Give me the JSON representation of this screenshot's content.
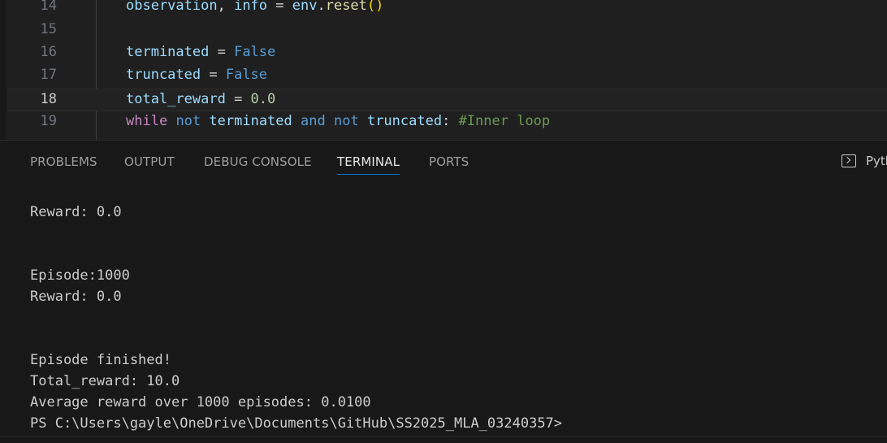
{
  "editor": {
    "lines": [
      {
        "number": "14",
        "code": "observation, info = env.reset()"
      },
      {
        "number": "15",
        "code": ""
      },
      {
        "number": "16",
        "code": "terminated = False"
      },
      {
        "number": "17",
        "code": "truncated = False"
      },
      {
        "number": "18",
        "code": "total_reward = 0.0"
      },
      {
        "number": "19",
        "code": "while not terminated and not truncated: #Inner loop"
      }
    ],
    "tokens": {
      "l14": [
        "observation",
        ", ",
        "info",
        " = ",
        "env",
        ".",
        "reset",
        "(",
        ")"
      ],
      "l16": [
        "terminated",
        " = ",
        "False"
      ],
      "l17": [
        "truncated",
        " = ",
        "False"
      ],
      "l18": [
        "total_reward",
        " = ",
        "0.0"
      ],
      "l19": [
        "while",
        " ",
        "not",
        " ",
        "terminated",
        " ",
        "and",
        " ",
        "not",
        " ",
        "truncated",
        ": ",
        "#Inner loop"
      ]
    }
  },
  "panel": {
    "tabs": [
      "PROBLEMS",
      "OUTPUT",
      "DEBUG CONSOLE",
      "TERMINAL",
      "PORTS"
    ],
    "active_tab": "TERMINAL",
    "terminal_profile_label": "Pyth"
  },
  "terminal": {
    "lines": [
      "Reward: 0.0",
      "",
      "",
      "Episode:1000",
      "Reward: 0.0",
      "",
      "",
      "Episode finished!",
      "Total_reward: 10.0",
      "Average reward over 1000 episodes: 0.0100",
      "PS C:\\Users\\gayle\\OneDrive\\Documents\\GitHub\\SS2025_MLA_03240357>"
    ]
  },
  "colors": {
    "background": "#1f1f1f",
    "panel": "#181818",
    "accent": "#0078d4",
    "keyword": "#569cd6",
    "control": "#c586c0",
    "variable": "#9cdcfe",
    "function": "#dcdcaa",
    "number": "#b5cea8",
    "comment": "#6a9955"
  }
}
